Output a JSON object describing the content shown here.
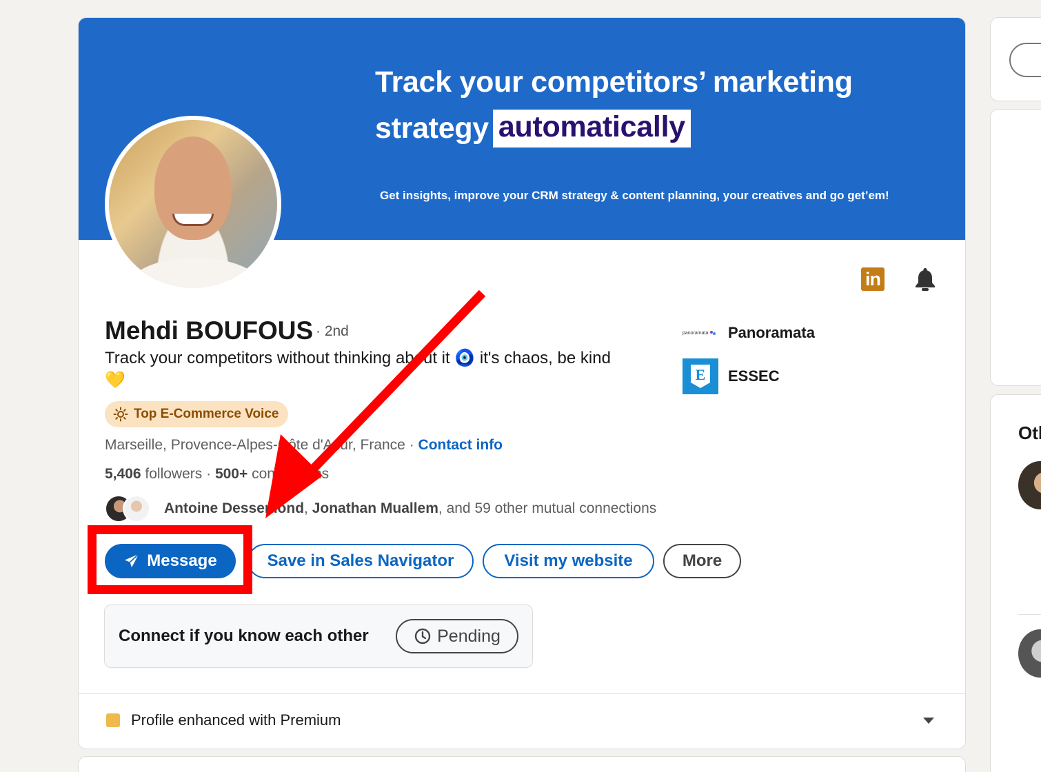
{
  "banner": {
    "line1": "Track your competitors’ marketing",
    "line2_plain": "strategy",
    "line2_highlight": "automatically",
    "subtitle": "Get insights, improve your CRM strategy & content planning, your creatives and go get’em!"
  },
  "profile": {
    "name": "Mehdi BOUFOUS",
    "degree": "· 2nd",
    "headline": "Track your competitors without thinking about it 🧿 it's chaos, be kind 💛",
    "badge": "Top E-Commerce Voice",
    "location": "Marseille, Provence-Alpes-Côte d'Azur, France",
    "location_sep": " · ",
    "contact_info": "Contact info",
    "followers_count": "5,406",
    "followers_label": " followers",
    "connections_sep": "  · ",
    "connections_count": "500+",
    "connections_label": " connections",
    "mutual_name1": "Antoine Dessemond",
    "mutual_sep": ", ",
    "mutual_name2": "Jonathan Muallem",
    "mutual_rest": ", and 59 other mutual connections"
  },
  "actions": {
    "message": "Message",
    "sales_navigator": "Save in Sales Navigator",
    "website": "Visit my website",
    "more": "More"
  },
  "connect": {
    "text": "Connect if you know each other",
    "pending": "Pending"
  },
  "orgs": {
    "company": "Panoramata",
    "company_logo_text": "panoramata",
    "school": "ESSEC",
    "school_logo_letter": "E"
  },
  "premium": {
    "text": "Profile enhanced with Premium"
  },
  "sidebar": {
    "section_title": "Otl"
  },
  "icons": {
    "linkedin": "linkedin-icon",
    "bell": "bell-icon",
    "send": "send-icon",
    "clock": "clock-icon",
    "sun": "sun-icon"
  },
  "colors": {
    "banner": "#1f6ac9",
    "primary": "#0a66c2",
    "annotation": "#ff0000",
    "badge_bg": "#fbe2c1",
    "badge_text": "#8a4d00"
  }
}
